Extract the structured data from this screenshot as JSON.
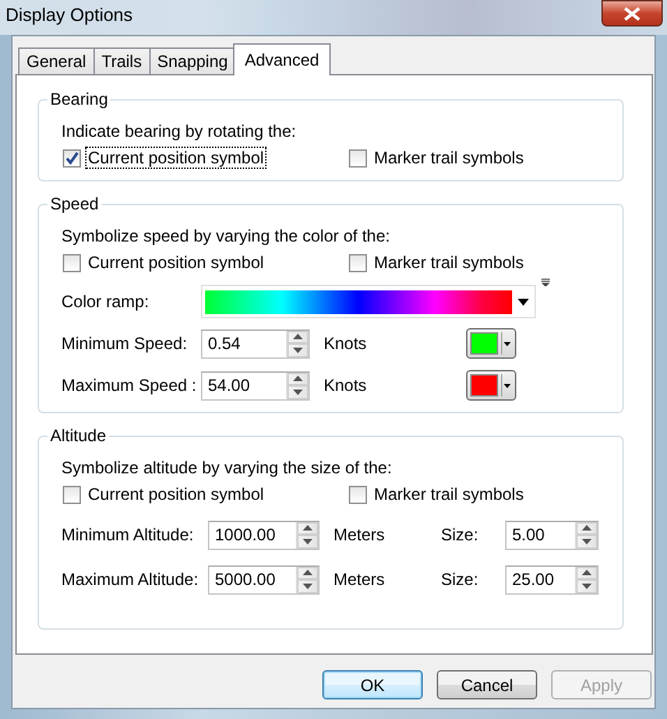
{
  "window": {
    "title": "Display Options"
  },
  "tabs": [
    {
      "label": "General",
      "selected": false
    },
    {
      "label": "Trails",
      "selected": false
    },
    {
      "label": "Snapping",
      "selected": false
    },
    {
      "label": "Advanced",
      "selected": true
    }
  ],
  "bearing": {
    "title": "Bearing",
    "prompt": "Indicate bearing by rotating the:",
    "options": [
      {
        "label": "Current position symbol",
        "checked": true
      },
      {
        "label": "Marker trail symbols",
        "checked": false
      }
    ]
  },
  "speed": {
    "title": "Speed",
    "prompt": "Symbolize speed by varying the color of the:",
    "options": [
      {
        "label": "Current position symbol",
        "checked": false
      },
      {
        "label": "Marker trail symbols",
        "checked": false
      }
    ],
    "color_ramp": {
      "label": "Color ramp:"
    },
    "rows": [
      {
        "label": "Minimum Speed:",
        "value": "0.54",
        "unit": "Knots",
        "color": "#00ff00"
      },
      {
        "label": "Maximum Speed :",
        "value": "54.00",
        "unit": "Knots",
        "color": "#ff0000"
      }
    ]
  },
  "altitude": {
    "title": "Altitude",
    "prompt": "Symbolize altitude by varying the size of the:",
    "options": [
      {
        "label": "Current position symbol",
        "checked": false
      },
      {
        "label": "Marker trail symbols",
        "checked": false
      }
    ],
    "rows": [
      {
        "label": "Minimum Altitude:",
        "value": "1000.00",
        "unit": "Meters",
        "size_label": "Size:",
        "size_value": "5.00"
      },
      {
        "label": "Maximum Altitude:",
        "value": "5000.00",
        "unit": "Meters",
        "size_label": "Size:",
        "size_value": "25.00"
      }
    ]
  },
  "buttons": [
    {
      "label": "OK",
      "default": true,
      "disabled": false
    },
    {
      "label": "Cancel",
      "default": false,
      "disabled": false
    },
    {
      "label": "Apply",
      "default": false,
      "disabled": true
    }
  ]
}
